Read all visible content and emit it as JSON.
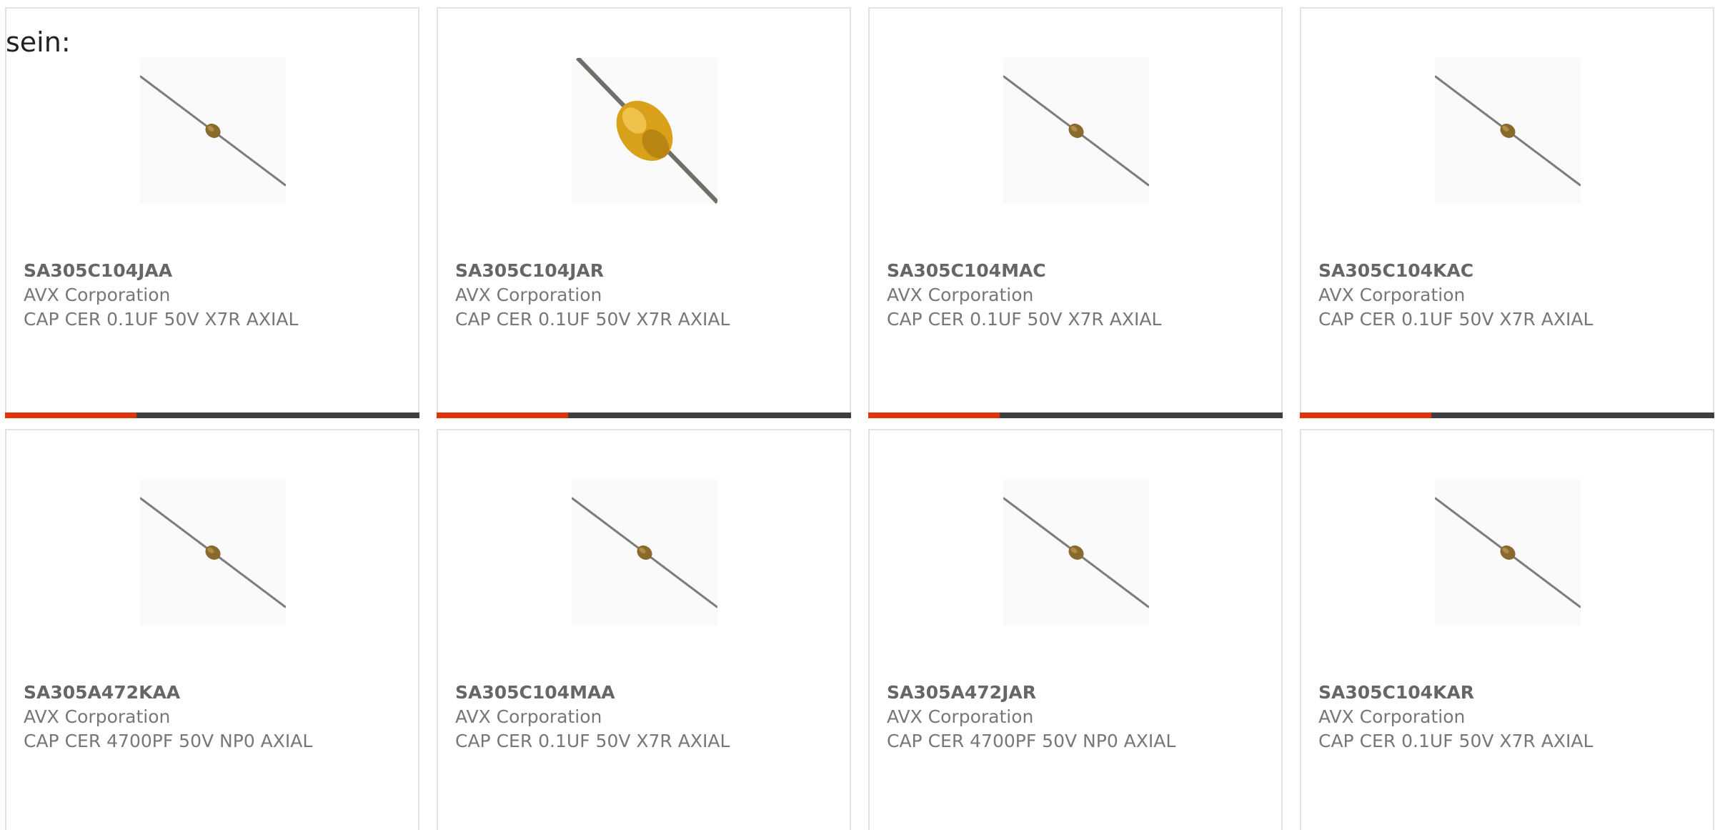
{
  "intro_text": "sein:",
  "accent_color": "#e0350c",
  "bar_color": "#3f3f3f",
  "products": [
    {
      "part": "SA305C104JAA",
      "manufacturer": "AVX Corporation",
      "description": "CAP CER 0.1UF 50V X7R AXIAL",
      "image": "axial-capacitor-small"
    },
    {
      "part": "SA305C104JAR",
      "manufacturer": "AVX Corporation",
      "description": "CAP CER 0.1UF 50V X7R AXIAL",
      "image": "axial-capacitor-large"
    },
    {
      "part": "SA305C104MAC",
      "manufacturer": "AVX Corporation",
      "description": "CAP CER 0.1UF 50V X7R AXIAL",
      "image": "axial-capacitor-small"
    },
    {
      "part": "SA305C104KAC",
      "manufacturer": "AVX Corporation",
      "description": "CAP CER 0.1UF 50V X7R AXIAL",
      "image": "axial-capacitor-small"
    },
    {
      "part": "SA305A472KAA",
      "manufacturer": "AVX Corporation",
      "description": "CAP CER 4700PF 50V NP0 AXIAL",
      "image": "axial-capacitor-small"
    },
    {
      "part": "SA305C104MAA",
      "manufacturer": "AVX Corporation",
      "description": "CAP CER 0.1UF 50V X7R AXIAL",
      "image": "axial-capacitor-small"
    },
    {
      "part": "SA305A472JAR",
      "manufacturer": "AVX Corporation",
      "description": "CAP CER 4700PF 50V NP0 AXIAL",
      "image": "axial-capacitor-small"
    },
    {
      "part": "SA305C104KAR",
      "manufacturer": "AVX Corporation",
      "description": "CAP CER 0.1UF 50V X7R AXIAL",
      "image": "axial-capacitor-small"
    }
  ]
}
